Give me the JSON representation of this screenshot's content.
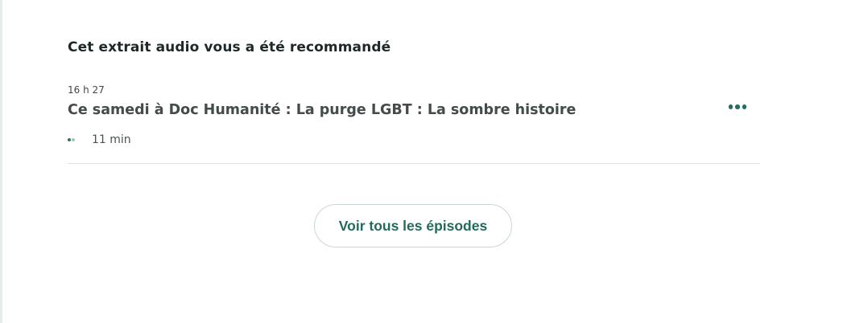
{
  "section": {
    "title": "Cet extrait audio vous a été recommandé"
  },
  "episode": {
    "time": "16 h 27",
    "title": "Ce samedi à Doc Humanité :  La purge LGBT :  La sombre histoire",
    "duration": "11 min",
    "more_icon": "more-horizontal-icon"
  },
  "actions": {
    "all_episodes_label": "Voir tous les épisodes"
  },
  "colors": {
    "accent": "#276e62",
    "text": "#1f2828",
    "divider": "#dde2e2"
  }
}
